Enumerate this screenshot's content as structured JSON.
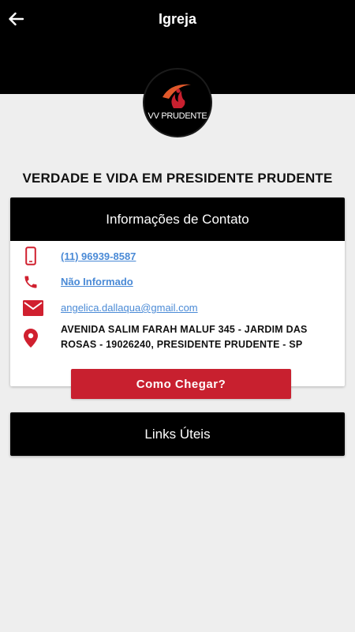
{
  "header": {
    "title": "Igreja",
    "back_icon": "arrow-left-icon"
  },
  "logo": {
    "text": "VV PRUDENTE"
  },
  "church": {
    "name": "VERDADE E VIDA EM PRESIDENTE PRUDENTE"
  },
  "contact": {
    "heading": "Informações de Contato",
    "mobile": "(11) 96939-8587",
    "phone": "Não Informado",
    "email": "angelica.dallaqua@gmail.com",
    "address": "AVENIDA SALIM FARAH MALUF 345 - JARDIM DAS ROSAS - 19026240, PRESIDENTE PRUDENTE - SP",
    "directions_label": "Como Chegar?"
  },
  "links": {
    "label": "Links Úteis"
  },
  "colors": {
    "accent": "#c8202f",
    "link": "#4a8ad6",
    "header_bg": "#000000",
    "page_bg": "#eeeeee"
  }
}
